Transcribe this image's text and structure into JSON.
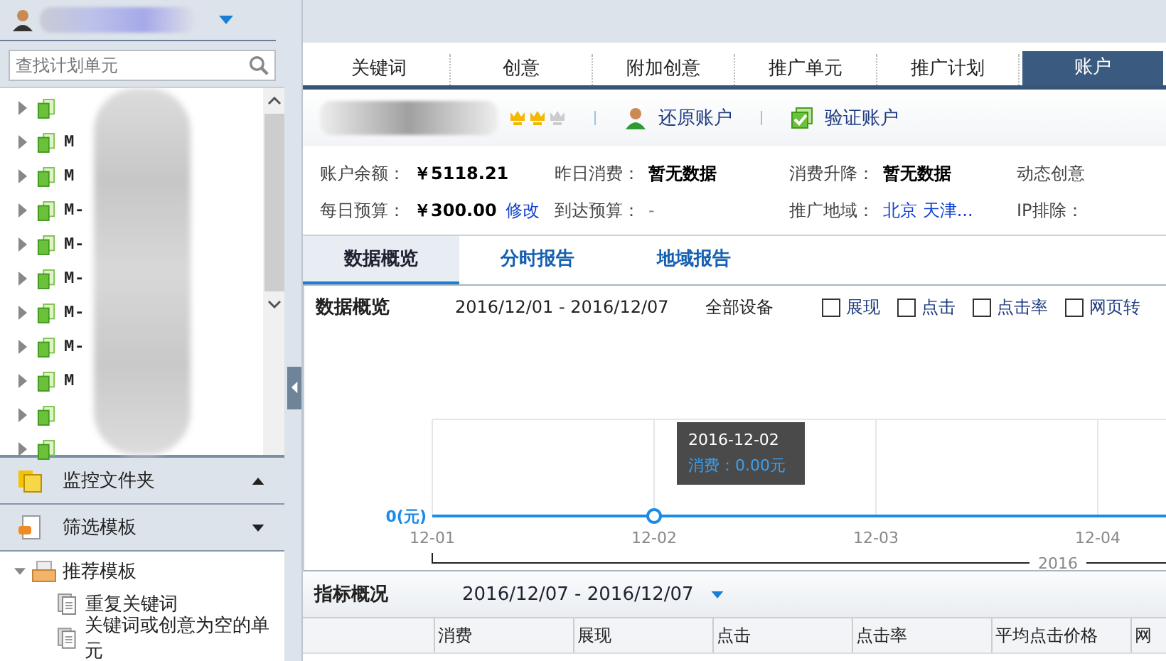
{
  "sidebar": {
    "search": {
      "placeholder": "查找计划单元"
    },
    "tree": [
      {
        "expanded": false
      },
      {
        "label": "M",
        "expanded": false
      },
      {
        "label": "M",
        "expanded": false
      },
      {
        "label": "M-",
        "expanded": false
      },
      {
        "label": "M-",
        "expanded": false
      },
      {
        "label": "M-",
        "expanded": false
      },
      {
        "label": "M-",
        "expanded": false
      },
      {
        "label": "M-",
        "expanded": false
      },
      {
        "label": "M",
        "expanded": false
      },
      {
        "expanded": false
      },
      {
        "expanded": false
      }
    ],
    "sections": [
      {
        "label": "监控文件夹",
        "expanded": false,
        "kind": "folder"
      },
      {
        "label": "筛选模板",
        "expanded": true,
        "kind": "template"
      }
    ],
    "templates": [
      {
        "label": "推荐模板",
        "expanded": true,
        "children": [
          {
            "label": "重复关键词"
          },
          {
            "label": "关键词或创意为空的单元"
          }
        ]
      }
    ]
  },
  "tabs": [
    {
      "label": "关键词",
      "selected": false
    },
    {
      "label": "创意",
      "selected": false
    },
    {
      "label": "附加创意",
      "selected": false
    },
    {
      "label": "推广单元",
      "selected": false
    },
    {
      "label": "推广计划",
      "selected": false
    },
    {
      "label": "账户",
      "selected": true
    }
  ],
  "account": {
    "stars": 2,
    "actions": [
      {
        "label": "还原账户",
        "kind": "restore"
      },
      {
        "label": "验证账户",
        "kind": "verify"
      }
    ],
    "fields": [
      [
        {
          "label": "账户余额：",
          "value": "￥5118.21",
          "kind": "bold"
        },
        {
          "label": "昨日消费：",
          "value": "暂无数据",
          "kind": "bold"
        },
        {
          "label": "消费升降：",
          "value": "暂无数据",
          "kind": "bold"
        },
        {
          "label": "动态创意"
        }
      ],
      [
        {
          "label": "每日预算：",
          "value": "￥300.00",
          "kind": "bold",
          "link": "修改"
        },
        {
          "label": "到达预算：",
          "value": "-",
          "kind": "plain"
        },
        {
          "label": "推广地域：",
          "value": "北京 天津...",
          "kind": "link"
        },
        {
          "label": "IP排除："
        }
      ]
    ]
  },
  "report_tabs": [
    {
      "label": "数据概览",
      "selected": true
    },
    {
      "label": "分时报告",
      "selected": false
    },
    {
      "label": "地域报告",
      "selected": false
    }
  ],
  "overview": {
    "title": "数据概览",
    "date_range": "2016/12/01 - 2016/12/07",
    "device": "全部设备",
    "metrics": [
      {
        "label": "展现",
        "checked": false
      },
      {
        "label": "点击",
        "checked": false
      },
      {
        "label": "点击率",
        "checked": false
      },
      {
        "label": "网页转",
        "checked": false
      }
    ],
    "x_labels": [
      "12-01",
      "12-02",
      "12-03",
      "12-04"
    ],
    "year_label": "2016",
    "y_axis_label": "0(元)",
    "tooltip": {
      "title": "2016-12-02",
      "text": "消费：0.00元"
    }
  },
  "metrics_summary": {
    "title": "指标概况",
    "date_range": "2016/12/07 - 2016/12/07",
    "columns": [
      "消费",
      "展现",
      "点击",
      "点击率",
      "平均点击价格",
      "网"
    ]
  }
}
